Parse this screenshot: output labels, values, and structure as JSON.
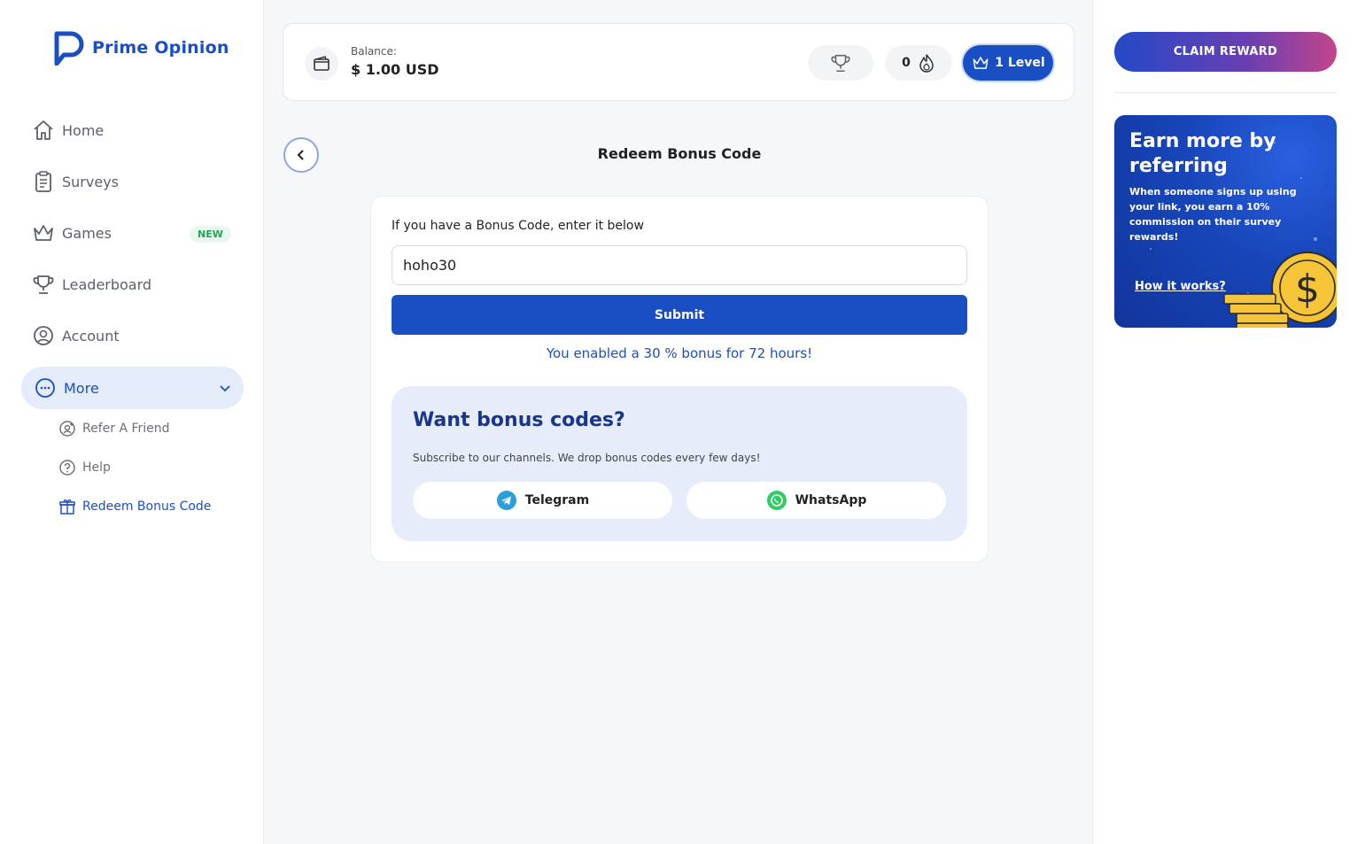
{
  "brand": {
    "name": "Prime Opinion",
    "color": "#1a4fc4"
  },
  "sidebar": {
    "items": [
      {
        "label": "Home",
        "icon": "home-icon"
      },
      {
        "label": "Surveys",
        "icon": "clipboard-icon"
      },
      {
        "label": "Games",
        "icon": "crown-icon",
        "badge": "NEW"
      },
      {
        "label": "Leaderboard",
        "icon": "trophy-icon"
      },
      {
        "label": "Account",
        "icon": "user-circle-icon"
      },
      {
        "label": "More",
        "icon": "more-circle-icon",
        "expanded": true
      }
    ],
    "sub_items": [
      {
        "label": "Refer A Friend",
        "icon": "refer-icon"
      },
      {
        "label": "Help",
        "icon": "help-icon"
      },
      {
        "label": "Redeem Bonus Code",
        "icon": "gift-icon",
        "active": true
      }
    ]
  },
  "header": {
    "balance_label": "Balance:",
    "balance_value": "$ 1.00 USD",
    "streak_count": "0",
    "level_label": "1 Level"
  },
  "page": {
    "title": "Redeem Bonus Code",
    "hint": "If you have a Bonus Code, enter it below",
    "code_value": "hoho30",
    "submit_label": "Submit",
    "success_message": "You enabled a 30 % bonus for 72 hours!"
  },
  "promo": {
    "title": "Want bonus codes?",
    "subtitle": "Subscribe to our channels. We drop bonus codes every few days!",
    "telegram_label": "Telegram",
    "whatsapp_label": "WhatsApp"
  },
  "right": {
    "claim_label": "CLAIM REWARD",
    "referral_title": "Earn more by referring",
    "referral_text": "When someone signs up using your link, you earn a 10% commission on their survey rewards!",
    "referral_link": "How it works?"
  }
}
